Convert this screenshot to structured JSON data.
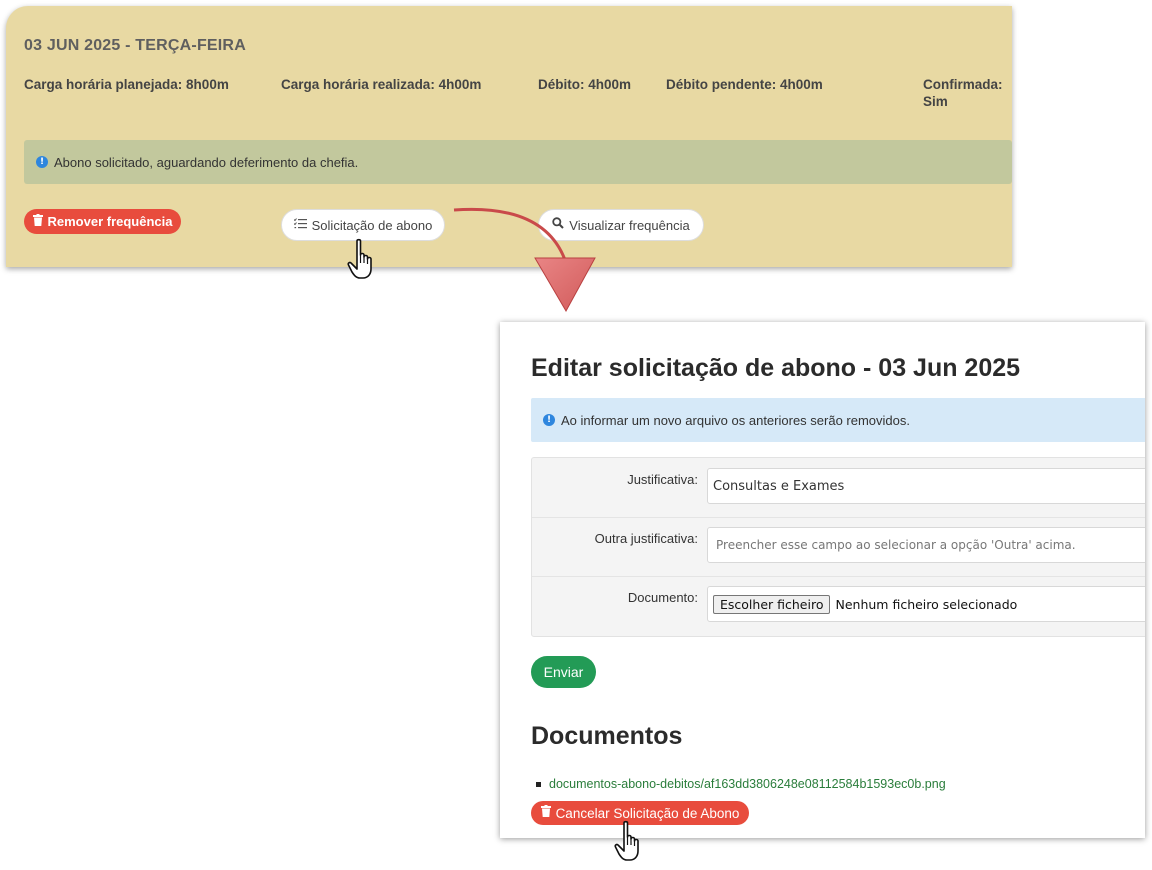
{
  "day_card": {
    "title": "03 JUN 2025 - TERÇA-FEIRA",
    "stats": {
      "planned": "Carga horária planejada: 8h00m",
      "realized": "Carga horária realizada: 4h00m",
      "debit": "Débito: 4h00m",
      "pending_debit": "Débito pendente: 4h00m",
      "confirmed_label": "Confirmada:",
      "confirmed_value": "Sim"
    },
    "info_message": "Abono solicitado, aguardando deferimento da chefia.",
    "buttons": {
      "remove": "Remover frequência",
      "request": "Solicitação de abono",
      "view": "Visualizar frequência"
    }
  },
  "edit_panel": {
    "title": "Editar solicitação de abono - 03 Jun 2025",
    "note": "Ao informar um novo arquivo os anteriores serão removidos.",
    "form": {
      "justification_label": "Justificativa:",
      "justification_value": "Consultas e Exames",
      "other_label": "Outra justificativa:",
      "other_placeholder": "Preencher esse campo ao selecionar a opção 'Outra' acima.",
      "document_label": "Documento:",
      "file_button": "Escolher ficheiro",
      "file_status": "Nenhum ficheiro selecionado"
    },
    "send_button": "Enviar",
    "documents_title": "Documentos",
    "documents": [
      "documentos-abono-debitos/af163dd3806248e08112584b1593ec0b.png"
    ],
    "cancel_button": "Cancelar Solicitação de Abono"
  },
  "colors": {
    "card_bg": "#e8d9a3",
    "danger": "#e84c3d",
    "success": "#239b56",
    "info_bg": "#d6e9f8",
    "arrow": "#c94a4a"
  }
}
